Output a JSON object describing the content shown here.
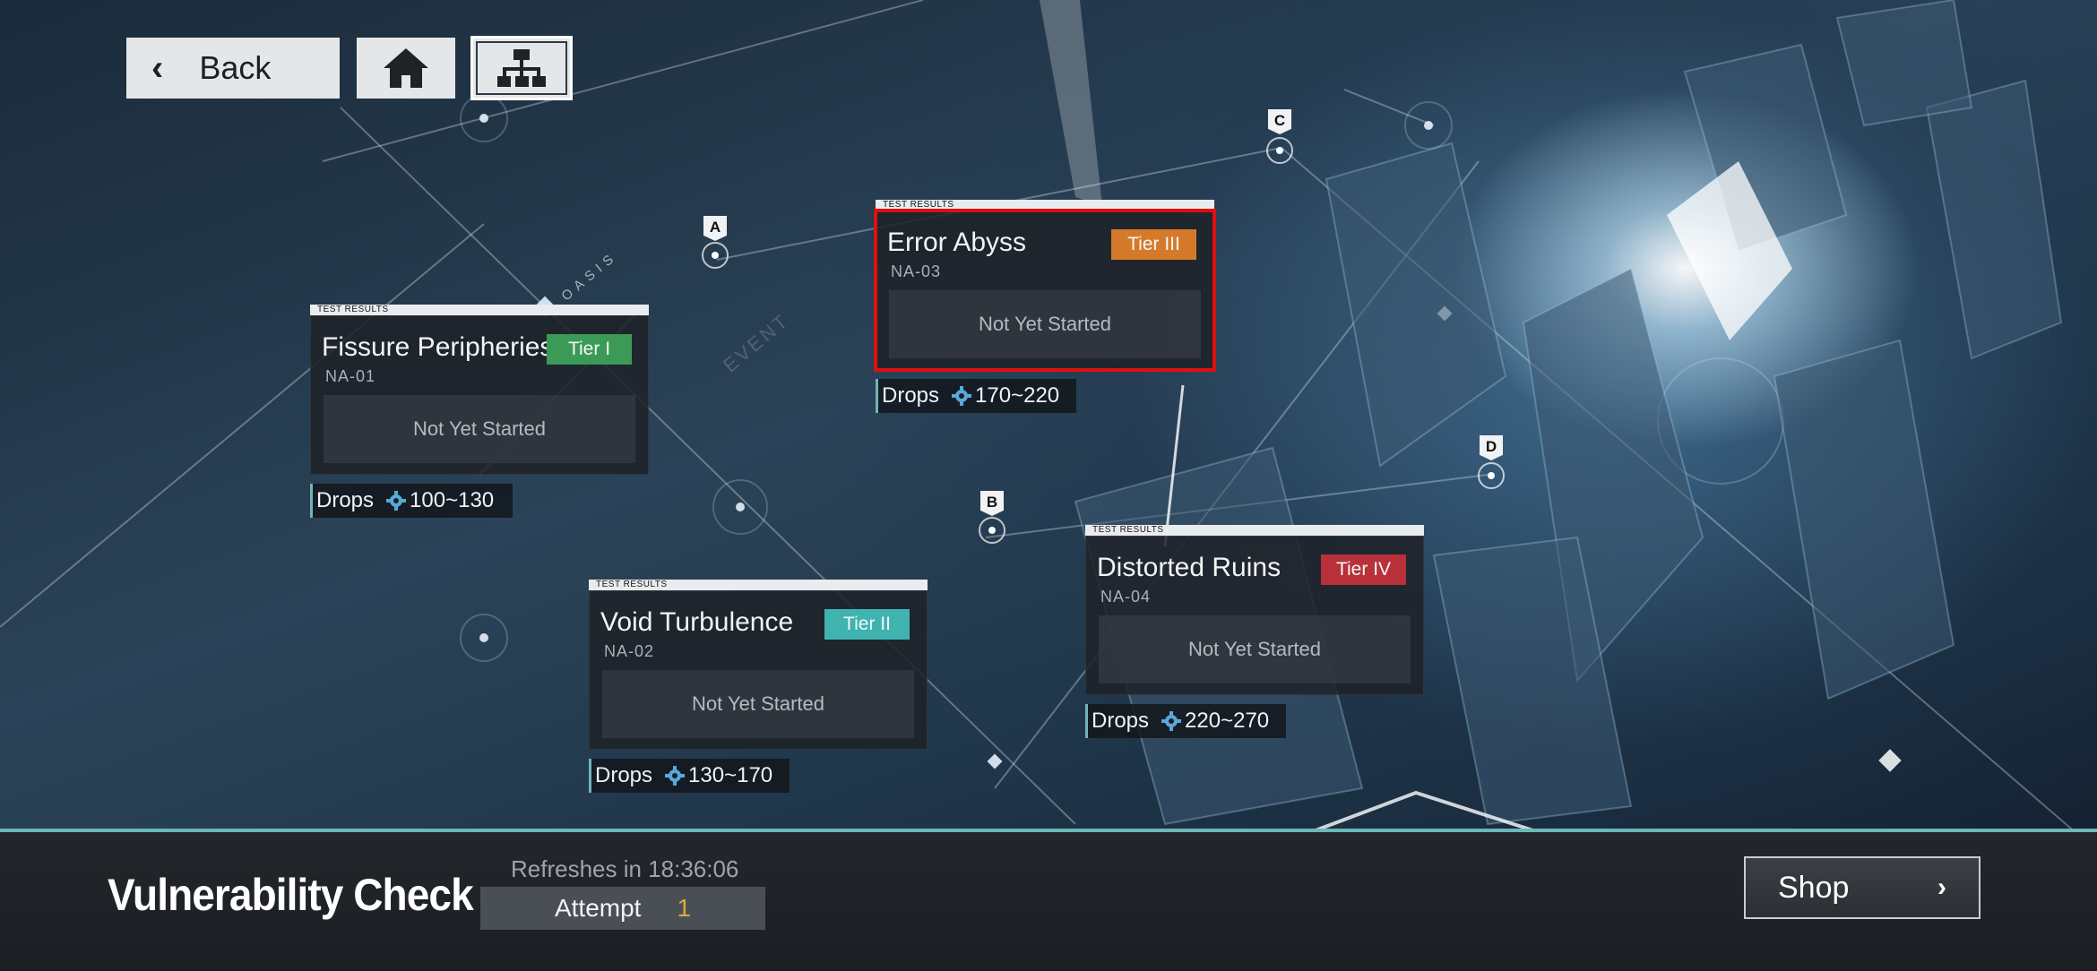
{
  "nav": {
    "back_label": "Back",
    "back_icon": "chevron-left-icon",
    "home_icon": "home-icon",
    "map_icon": "hierarchy-icon"
  },
  "watermarks": {
    "oasis": "OASIS",
    "event": "EVENT"
  },
  "nodes": {
    "a": "A",
    "b": "B",
    "c": "C",
    "d": "D"
  },
  "stages": [
    {
      "tag": "TEST RESULTS",
      "title": "Fissure Peripheries",
      "code": "NA-01",
      "tier": "Tier I",
      "tier_color": "#3a9a56",
      "status": "Not Yet Started",
      "drops_label": "Drops",
      "drops_range": "100~130"
    },
    {
      "tag": "TEST RESULTS",
      "title": "Void Turbulence",
      "code": "NA-02",
      "tier": "Tier II",
      "tier_color": "#3fb3b0",
      "status": "Not Yet Started",
      "drops_label": "Drops",
      "drops_range": "130~170"
    },
    {
      "tag": "TEST RESULTS",
      "title": "Error Abyss",
      "code": "NA-03",
      "tier": "Tier III",
      "tier_color": "#d57a2a",
      "status": "Not Yet Started",
      "drops_label": "Drops",
      "drops_range": "170~220",
      "selected": true
    },
    {
      "tag": "TEST RESULTS",
      "title": "Distorted Ruins",
      "code": "NA-04",
      "tier": "Tier IV",
      "tier_color": "#b8303a",
      "status": "Not Yet Started",
      "drops_label": "Drops",
      "drops_range": "220~270"
    }
  ],
  "footer": {
    "title": "Vulnerability Check",
    "refresh_text": "Refreshes in 18:36:06",
    "attempt_label": "Attempt",
    "attempt_count": "1",
    "shop_label": "Shop",
    "shop_icon": "chevron-right-icon"
  },
  "colors": {
    "accent": "#6ab9b8",
    "selected_outline": "#e01010",
    "attempt_number": "#e2a63a"
  }
}
